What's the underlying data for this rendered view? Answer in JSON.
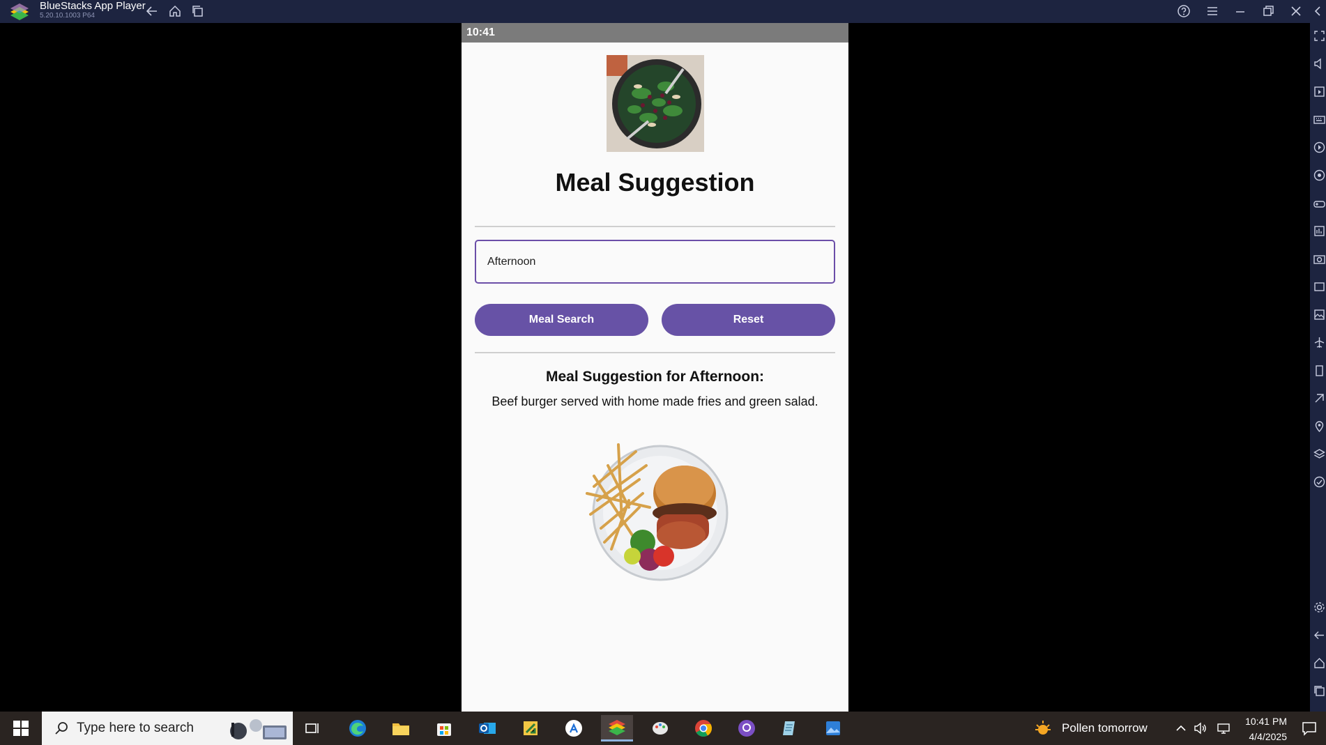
{
  "window": {
    "title": "BlueStacks App Player",
    "version": "5.20.10.1003  P64",
    "icons": [
      "back-arrow-icon",
      "home-icon",
      "multi-instance-icon",
      "help-icon",
      "menu-icon",
      "minimize-icon",
      "restore-icon",
      "close-icon",
      "collapse-sidebar-icon"
    ]
  },
  "android": {
    "status_time": "10:41",
    "app": {
      "title": "Meal Suggestion",
      "input_value": "Afternoon",
      "search_button": "Meal Search",
      "reset_button": "Reset",
      "result_heading": "Meal Suggestion for Afternoon:",
      "result_text": "Beef burger served with home made fries and green salad."
    }
  },
  "taskbar": {
    "search_placeholder": "Type here to search",
    "weather": "Pollen tomorrow",
    "time": "10:41 PM",
    "date": "4/4/2025",
    "apps": [
      "task-view",
      "edge",
      "file-explorer",
      "microsoft-store",
      "outlook",
      "sticky-app",
      "app-store",
      "bluestacks",
      "paint",
      "chrome",
      "github",
      "notepad",
      "photos"
    ]
  },
  "colors": {
    "accent": "#6752a6",
    "input_border": "#6b4ea8",
    "titlebar": "#1d2440",
    "taskbar": "#2a2421"
  }
}
